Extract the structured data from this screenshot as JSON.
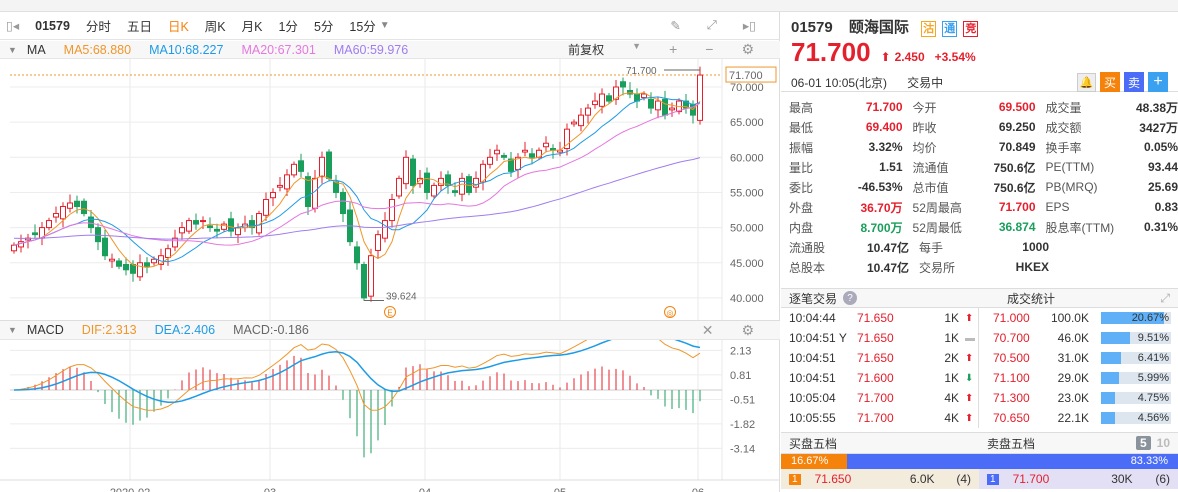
{
  "toolbar": {
    "code": "01579",
    "tabs": [
      "分时",
      "五日",
      "日K",
      "周K",
      "月K",
      "1分",
      "5分",
      "15分"
    ],
    "active": "日K"
  },
  "ma": {
    "label": "MA",
    "ma5": "MA5:68.880",
    "ma10": "MA10:68.227",
    "ma20": "MA20:67.301",
    "ma60": "MA60:59.976",
    "adjust": "前复权"
  },
  "colors": {
    "up": "#e4202d",
    "down": "#1a9e5c",
    "ma5": "#f0962a",
    "ma10": "#1e9be6",
    "ma20": "#e577e0",
    "ma60": "#a07cf0"
  },
  "macd": {
    "label": "MACD",
    "dif": "DIF:2.313",
    "dea": "DEA:2.406",
    "macd": "MACD:-0.186",
    "ticks": [
      "2.13",
      "0.81",
      "-0.51",
      "-1.82",
      "-3.14"
    ]
  },
  "chart_data": {
    "type": "candlestick",
    "price_ticks": [
      "70.000",
      "65.000",
      "60.000",
      "55.000",
      "50.000",
      "45.000",
      "40.000"
    ],
    "last_price_label": "71.700",
    "high_label": "71.700",
    "low_label": "39.624",
    "x_ticks": [
      "2020-02",
      "03",
      "04",
      "05",
      "06"
    ],
    "ylim": [
      38,
      73
    ],
    "closes": [
      47.5,
      48,
      48.5,
      49,
      50,
      51,
      52,
      53,
      53.5,
      53,
      52,
      50,
      48,
      46,
      45.5,
      44.5,
      44,
      43.5,
      45,
      44.5,
      45.5,
      46,
      47,
      48.5,
      50,
      51,
      50.5,
      51,
      50,
      49.5,
      50.5,
      49.5,
      50,
      50.5,
      50,
      52,
      54,
      55,
      56,
      57.5,
      59,
      58,
      53,
      57,
      60,
      57,
      55,
      52,
      48,
      45,
      40,
      46,
      49,
      51,
      54,
      57,
      60,
      56,
      57,
      55,
      56,
      57,
      56,
      55,
      57,
      55,
      57,
      59,
      60,
      61,
      60,
      58,
      60,
      61,
      60,
      61,
      62,
      61,
      61,
      64,
      65,
      66,
      67,
      68,
      69,
      68,
      70,
      70,
      69,
      68,
      69,
      67,
      68,
      66,
      67,
      68,
      67,
      66,
      71.7
    ],
    "event_markers": [
      "E",
      "◎"
    ]
  },
  "quote": {
    "code": "01579",
    "name": "颐海国际",
    "badges": [
      "沽",
      "通",
      "竞"
    ],
    "price": "71.700",
    "change": "2.450",
    "pct": "+3.54%",
    "time": "06-01  10:05(北京)",
    "status": "交易中",
    "buy": "买",
    "sell": "卖",
    "add": "+"
  },
  "stats": [
    [
      [
        "最高",
        "71.700",
        "red"
      ],
      [
        "今开",
        "69.500",
        "red"
      ],
      [
        "成交量",
        "48.38万",
        ""
      ]
    ],
    [
      [
        "最低",
        "69.400",
        "red"
      ],
      [
        "昨收",
        "69.250",
        ""
      ],
      [
        "成交额",
        "3427万",
        ""
      ]
    ],
    [
      [
        "振幅",
        "3.32%",
        ""
      ],
      [
        "均价",
        "70.849",
        ""
      ],
      [
        "换手率",
        "0.05%",
        ""
      ]
    ],
    [
      [
        "量比",
        "1.51",
        ""
      ],
      [
        "流通值",
        "750.6亿",
        ""
      ],
      [
        "PE(TTM)",
        "93.44",
        ""
      ]
    ],
    [
      [
        "委比",
        "-46.53%",
        ""
      ],
      [
        "总市值",
        "750.6亿",
        ""
      ],
      [
        "PB(MRQ)",
        "25.69",
        ""
      ]
    ],
    [
      [
        "外盘",
        "36.70万",
        "red"
      ],
      [
        "52周最高",
        "71.700",
        "red"
      ],
      [
        "EPS",
        "0.83",
        ""
      ]
    ],
    [
      [
        "内盘",
        "8.700万",
        "green"
      ],
      [
        "52周最低",
        "36.874",
        "green"
      ],
      [
        "股息率(TTM)",
        "0.31%",
        ""
      ]
    ],
    [
      [
        "流通股",
        "10.47亿",
        ""
      ],
      [
        "每手",
        "1000",
        ""
      ],
      [
        "",
        "",
        " "
      ]
    ],
    [
      [
        "总股本",
        "10.47亿",
        ""
      ],
      [
        "交易所",
        "HKEX",
        ""
      ],
      [
        "",
        "",
        " "
      ]
    ]
  ],
  "ticks_title": "逐笔交易",
  "stat_title": "成交统计",
  "ticks": [
    {
      "t": "10:04:44",
      "p": "71.650",
      "v": "1K",
      "d": "up"
    },
    {
      "t": "10:04:51 Y",
      "p": "71.650",
      "v": "1K",
      "d": "flat"
    },
    {
      "t": "10:04:51",
      "p": "71.650",
      "v": "2K",
      "d": "up"
    },
    {
      "t": "10:04:51",
      "p": "71.600",
      "v": "1K",
      "d": "down"
    },
    {
      "t": "10:05:04",
      "p": "71.700",
      "v": "4K",
      "d": "up"
    },
    {
      "t": "10:05:55",
      "p": "71.700",
      "v": "4K",
      "d": "up"
    }
  ],
  "stat_rows": [
    {
      "p": "71.000",
      "v": "100.0K",
      "pct": "20.67%",
      "f": 0.9
    },
    {
      "p": "70.700",
      "v": "46.0K",
      "pct": "9.51%",
      "f": 0.41
    },
    {
      "p": "70.500",
      "v": "31.0K",
      "pct": "6.41%",
      "f": 0.28
    },
    {
      "p": "71.100",
      "v": "29.0K",
      "pct": "5.99%",
      "f": 0.26
    },
    {
      "p": "71.300",
      "v": "23.0K",
      "pct": "4.75%",
      "f": 0.2
    },
    {
      "p": "70.650",
      "v": "22.1K",
      "pct": "4.56%",
      "f": 0.2
    }
  ],
  "depth": {
    "buy_title": "买盘五档",
    "sell_title": "卖盘五档",
    "opt5": "5",
    "opt10": "10",
    "buy_pct": "16.67%",
    "sell_pct": "83.33%",
    "buy_frac": 0.1667,
    "buy": {
      "lvl": "1",
      "p": "71.650",
      "v": "6.0K",
      "n": "(4)"
    },
    "sell": {
      "lvl": "1",
      "p": "71.700",
      "v": "30K",
      "n": "(6)"
    }
  }
}
